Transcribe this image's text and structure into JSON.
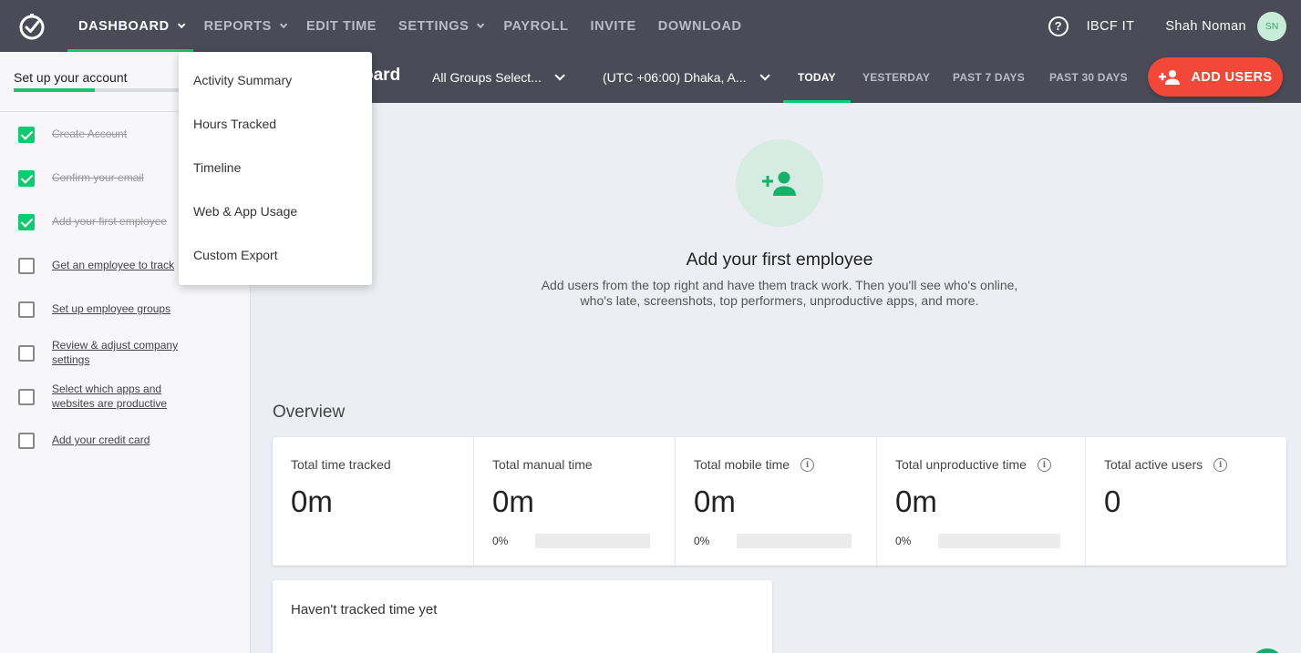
{
  "nav": {
    "items": [
      {
        "label": "DASHBOARD",
        "caret": true
      },
      {
        "label": "REPORTS",
        "caret": true
      },
      {
        "label": "EDIT TIME",
        "caret": false
      },
      {
        "label": "SETTINGS",
        "caret": true
      },
      {
        "label": "PAYROLL",
        "caret": false
      },
      {
        "label": "INVITE",
        "caret": false
      },
      {
        "label": "DOWNLOAD",
        "caret": false
      }
    ],
    "active": "DASHBOARD",
    "company": "IBCF IT",
    "username": "Shah Noman",
    "avatar_initials": "SN"
  },
  "subbar": {
    "page_title_fragment": "oard",
    "groups_select": "All Groups Select...",
    "timezone_select": "(UTC +06:00) Dhaka, A...",
    "ranges": [
      "TODAY",
      "YESTERDAY",
      "PAST 7 DAYS",
      "PAST 30 DAYS"
    ],
    "active_range": "TODAY",
    "add_users_label": "ADD USERS"
  },
  "reports_menu": {
    "items": [
      "Activity Summary",
      "Hours Tracked",
      "Timeline",
      "Web & App Usage",
      "Custom Export"
    ]
  },
  "sidebar": {
    "title": "Set up your account",
    "progress": 0.48,
    "tasks": [
      {
        "label": "Create Account",
        "done": true
      },
      {
        "label": "Confirm your email",
        "done": true
      },
      {
        "label": "Add your first employee",
        "done": true
      },
      {
        "label": "Get an employee to track",
        "done": false
      },
      {
        "label": "Set up employee groups",
        "done": false
      },
      {
        "label": "Review & adjust company settings",
        "done": false
      },
      {
        "label": "Select which apps and websites are productive",
        "done": false
      },
      {
        "label": "Add your credit card",
        "done": false
      }
    ]
  },
  "empty_state": {
    "title": "Add your first employee",
    "description_line1": "Add users from the top right and have them track work. Then you'll see who's online,",
    "description_line2": "who's late, screenshots, top performers, unproductive apps, and more."
  },
  "overview": {
    "title": "Overview",
    "metrics": [
      {
        "label": "Total time tracked",
        "value": "0m",
        "info": false,
        "pct": null
      },
      {
        "label": "Total manual time",
        "value": "0m",
        "info": false,
        "pct": "0%"
      },
      {
        "label": "Total mobile time",
        "value": "0m",
        "info": true,
        "pct": "0%"
      },
      {
        "label": "Total unproductive time",
        "value": "0m",
        "info": true,
        "pct": "0%"
      },
      {
        "label": "Total active users",
        "value": "0",
        "info": true,
        "pct": null
      }
    ]
  },
  "tracked_card": {
    "title": "Haven't tracked time yet"
  },
  "colors": {
    "nav_bg": "#4a4b57",
    "accent_green": "#17c671",
    "add_users_red": "#f2483a"
  },
  "icons": {
    "logo": "clock-check-icon",
    "help": "question-circle-icon",
    "add_user": "person-add-icon",
    "info": "info-circle-icon"
  }
}
